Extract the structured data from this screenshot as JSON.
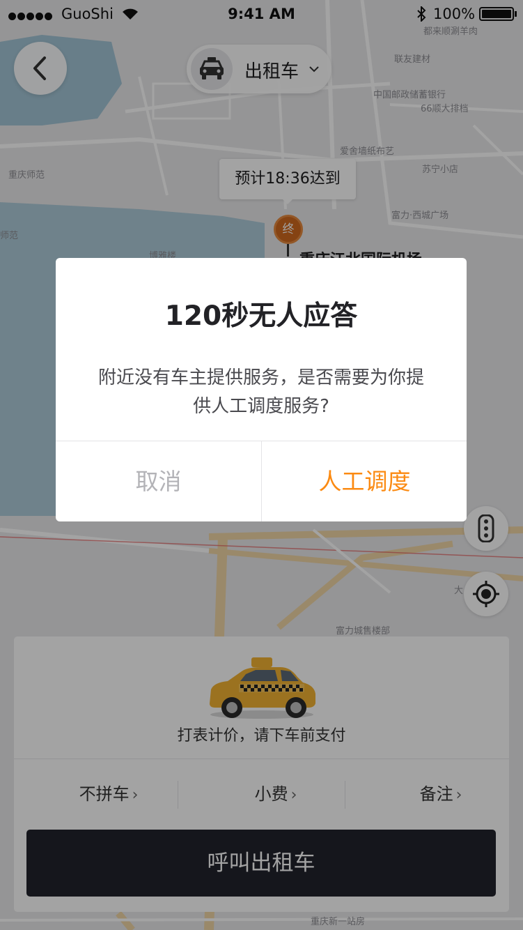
{
  "status_bar": {
    "carrier": "GuoShi",
    "time": "9:41 AM",
    "battery": "100%"
  },
  "map": {
    "labels": {
      "dulai": "都来顺涮羊肉",
      "lianyou": "联友建材",
      "postal_bank": "中国邮政储蓄银行",
      "paidang": "66顺大排档",
      "aishe": "爱舍墙纸布艺",
      "suning": "苏宁小店",
      "normal_univ": "重庆师范",
      "fuli_xicheng": "富力·西城广场",
      "normal_univ_short": "师范",
      "boya": "博雅楼",
      "fuli_sales": "富力城售楼部",
      "station": "重庆新一站房",
      "da": "大"
    },
    "destination_name": "重庆江北国际机场",
    "destination_pin": "终",
    "eta": "预计18:36达到"
  },
  "top_bar": {
    "mode_label": "出租车"
  },
  "dialog": {
    "title": "120秒无人应答",
    "message_line1": "附近没有车主提供服务，是否需要为你提",
    "message_line2": "供人工调度服务?",
    "cancel_label": "取消",
    "confirm_label": "人工调度"
  },
  "order_card": {
    "fare_text": "打表计价，请下车前支付",
    "options": {
      "no_carpool": "不拼车",
      "tip": "小费",
      "note": "备注"
    },
    "chevron": "›",
    "call_button": "呼叫出租车"
  },
  "colors": {
    "accent": "#fb8a12",
    "primary_button": "#22232c",
    "pin": "#d06a1e"
  }
}
